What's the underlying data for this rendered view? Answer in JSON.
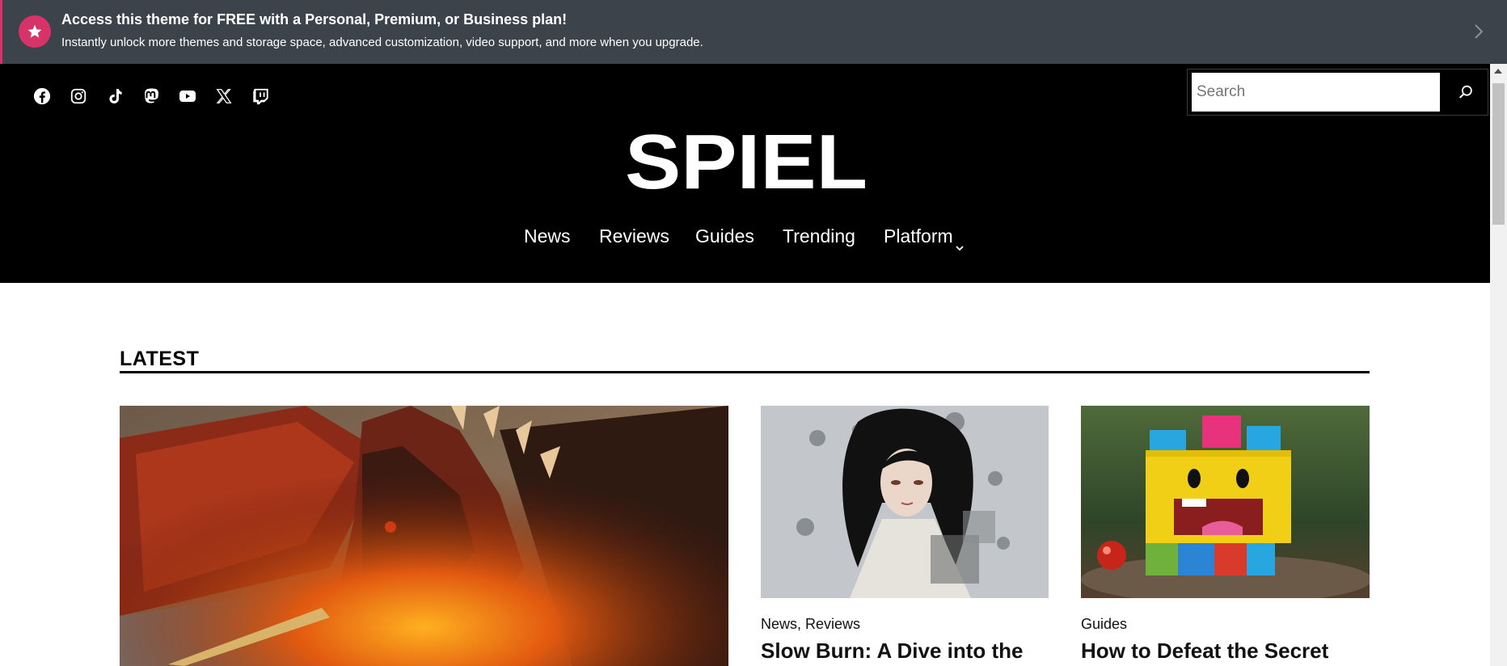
{
  "banner": {
    "title": "Access this theme for FREE with a Personal, Premium, or Business plan!",
    "subtitle": "Instantly unlock more themes and storage space, advanced customization, video support, and more when you upgrade.",
    "icon": "star-icon",
    "accent_color": "#d63369"
  },
  "header": {
    "social": [
      "facebook-icon",
      "instagram-icon",
      "tiktok-icon",
      "mastodon-icon",
      "youtube-icon",
      "x-icon",
      "twitch-icon"
    ],
    "search": {
      "placeholder": "Search",
      "value": ""
    },
    "logo": "SPIEL",
    "nav": [
      {
        "label": "News"
      },
      {
        "label": "Reviews"
      },
      {
        "label": "Guides"
      },
      {
        "label": "Trending"
      },
      {
        "label": "Platform",
        "has_dropdown": true
      }
    ]
  },
  "main": {
    "section_title": "LATEST",
    "posts": [
      {
        "image": "dragon illustration",
        "categories": "",
        "title": ""
      },
      {
        "image": "dark-haired anime woman illustration",
        "categories": "News, Reviews",
        "title": "Slow Burn: A Dive into the"
      },
      {
        "image": "yellow toy block robot with colorful cubes",
        "categories": "Guides",
        "title": "How to Defeat the Secret"
      }
    ]
  }
}
